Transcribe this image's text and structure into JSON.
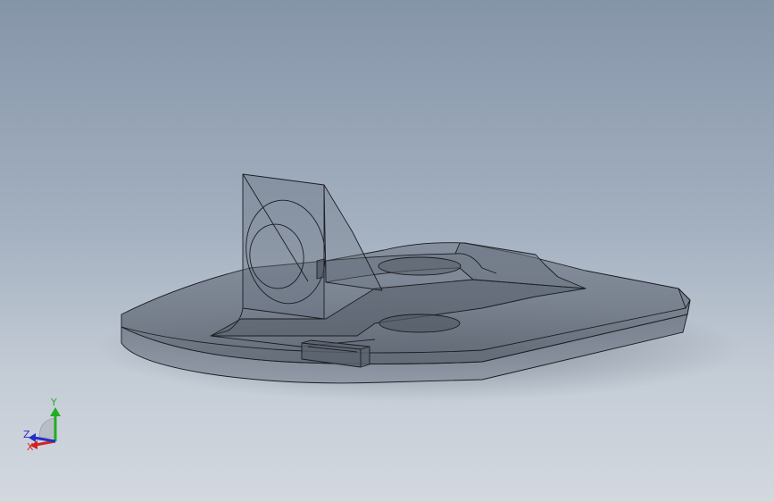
{
  "viewport": {
    "background_top": "#8595a8",
    "background_bottom": "#d3d8df",
    "model_fill": "#5f6875",
    "edge_color": "#1a1d22"
  },
  "triad": {
    "x_label": "X",
    "y_label": "Y",
    "z_label": "Z",
    "x_color": "#d42020",
    "y_color": "#1fae1f",
    "z_color": "#2030c8"
  }
}
